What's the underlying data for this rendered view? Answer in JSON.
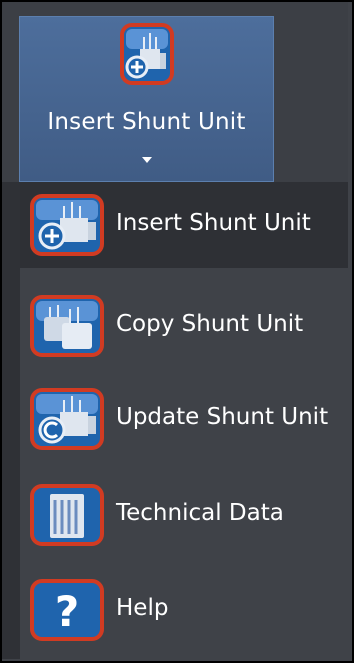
{
  "ribbon": {
    "button_label": "Insert Shunt Unit",
    "button_icon": "insert-shunt-unit-icon"
  },
  "menu": {
    "items": [
      {
        "label": "Insert Shunt Unit",
        "icon": "insert-shunt-unit-icon",
        "highlighted": true
      },
      {
        "label": "Copy Shunt Unit",
        "icon": "copy-shunt-unit-icon",
        "highlighted": false
      },
      {
        "label": "Update Shunt Unit",
        "icon": "update-shunt-unit-icon",
        "highlighted": false
      },
      {
        "label": "Technical Data",
        "icon": "technical-data-icon",
        "highlighted": false
      },
      {
        "label": "Help",
        "icon": "help-icon",
        "highlighted": false
      }
    ]
  },
  "colors": {
    "icon_border": "#d13b22",
    "icon_fill": "#1f64ad",
    "ribbon_active": "#4a6a97",
    "menu_background": "#3f4248",
    "menu_highlight": "#2e3035"
  }
}
